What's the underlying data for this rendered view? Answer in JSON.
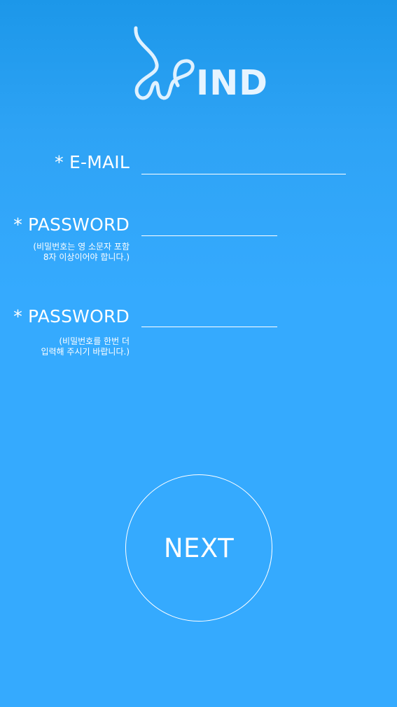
{
  "logo": {
    "text": "IND"
  },
  "form": {
    "email": {
      "label": "* E-MAIL",
      "value": ""
    },
    "password": {
      "label": "* PASSWORD",
      "hint_line1": "(비밀번호는 영 소문자 포함",
      "hint_line2": "8자 이상이어야 합니다.)",
      "value": ""
    },
    "password_confirm": {
      "label": "* PASSWORD",
      "hint_line1": "(비밀번호를 한번 더",
      "hint_line2": "입력해 주시기 바랍니다.)",
      "value": ""
    }
  },
  "next_button": {
    "label": "NEXT"
  },
  "colors": {
    "background_top": "#1c97e9",
    "background": "#35aafe",
    "text": "#ffffff",
    "logo_text": "#e6f4ff"
  }
}
